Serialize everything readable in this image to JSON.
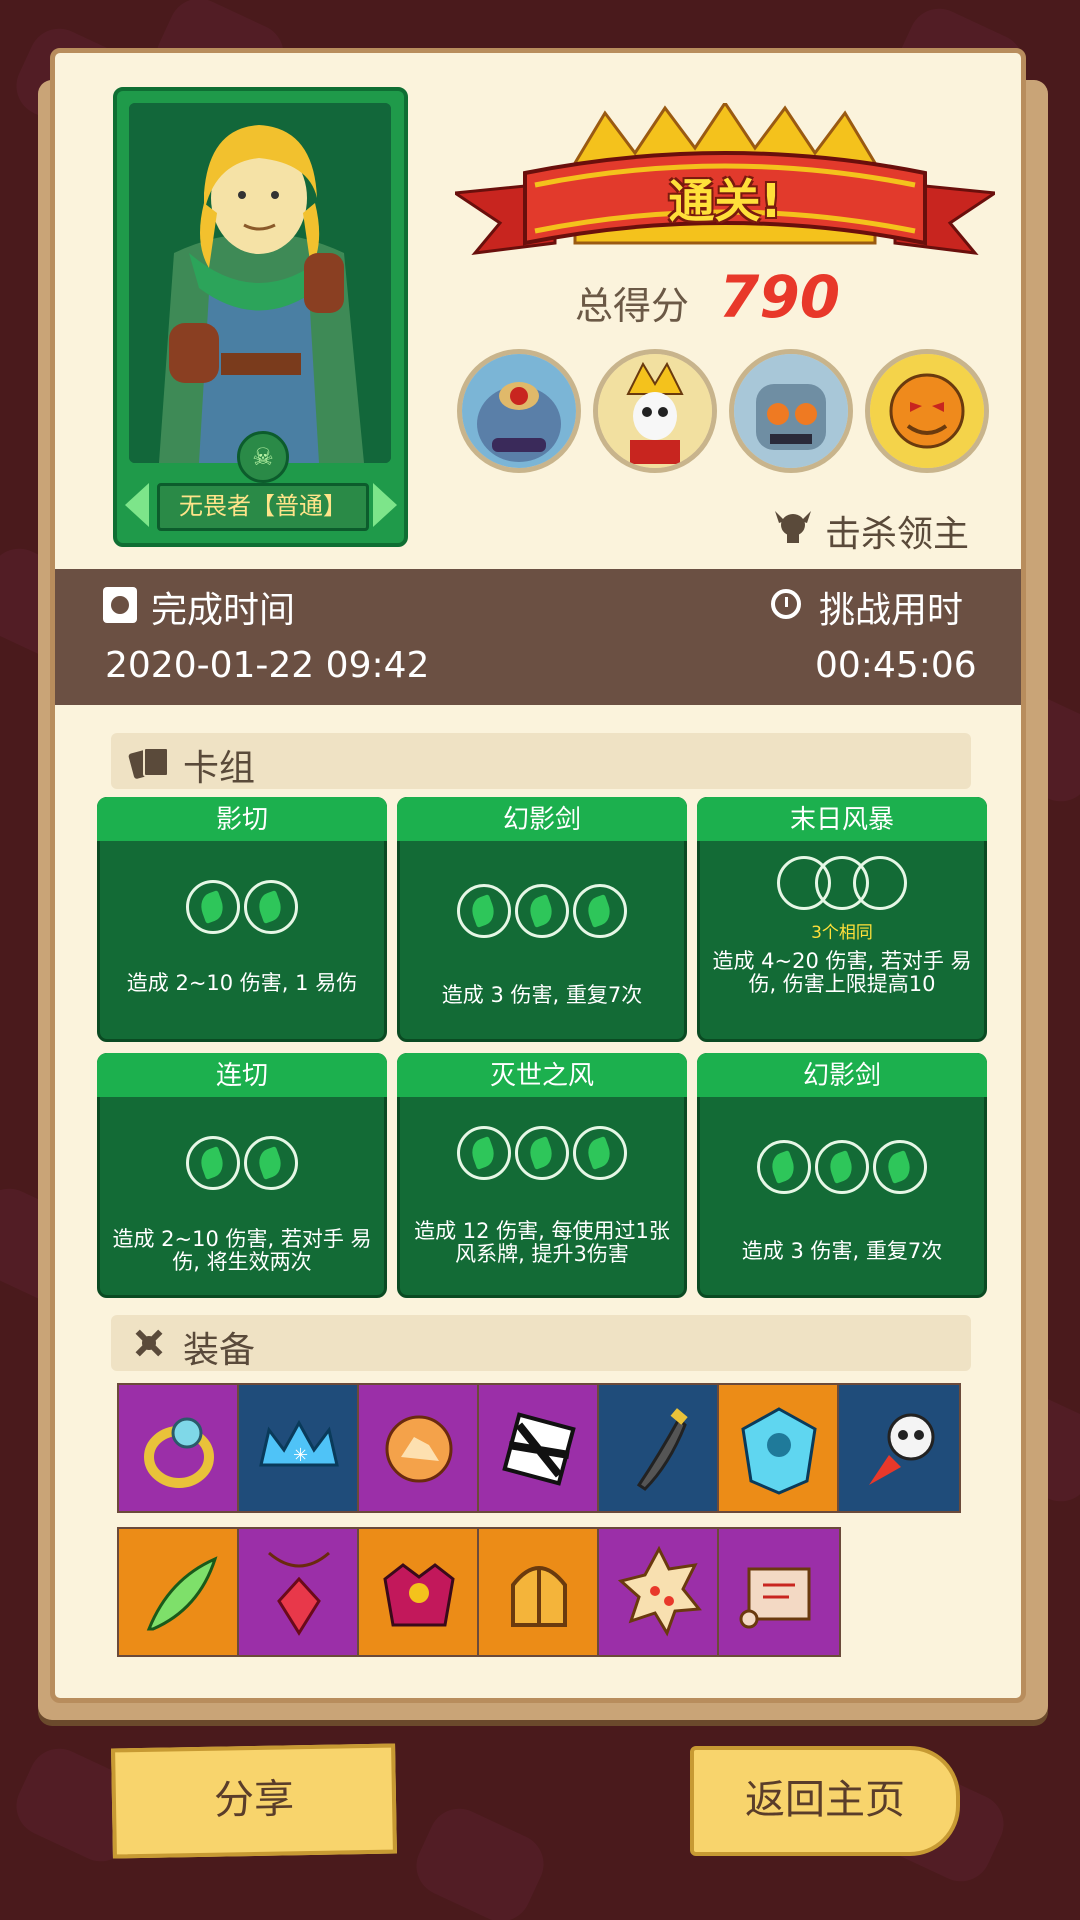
{
  "hero": {
    "name": "无畏者【普通】"
  },
  "result": {
    "title": "通关!",
    "score_label": "总得分",
    "score_value": "790",
    "kill_label": "击杀领主"
  },
  "times": {
    "complete_label": "完成时间",
    "complete_value": "2020-01-22 09:42",
    "duration_label": "挑战用时",
    "duration_value": "00:45:06"
  },
  "deck": {
    "title": "卡组",
    "cards": [
      {
        "name": "影切",
        "desc": "造成 2~10 伤害, 1 易伤"
      },
      {
        "name": "幻影剑",
        "desc": "造成 3 伤害, 重复7次"
      },
      {
        "name": "末日风暴",
        "note": "3个相同",
        "desc": "造成 4~20 伤害, 若对手 易伤, 伤害上限提高10"
      },
      {
        "name": "连切",
        "desc": "造成 2~10 伤害, 若对手 易伤, 将生效两次"
      },
      {
        "name": "灭世之风",
        "desc": "造成 12 伤害, 每使用过1张 风系牌, 提升3伤害"
      },
      {
        "name": "幻影剑",
        "desc": "造成 3 伤害, 重复7次"
      }
    ]
  },
  "equipment": {
    "title": "装备"
  },
  "buttons": {
    "share": "分享",
    "home": "返回主页"
  },
  "colors": {
    "accent_red": "#e8382a",
    "card_green": "#136b36",
    "slot_purple": "#9b2fa8",
    "slot_blue": "#1f4c7a",
    "slot_orange": "#ec8c17"
  }
}
